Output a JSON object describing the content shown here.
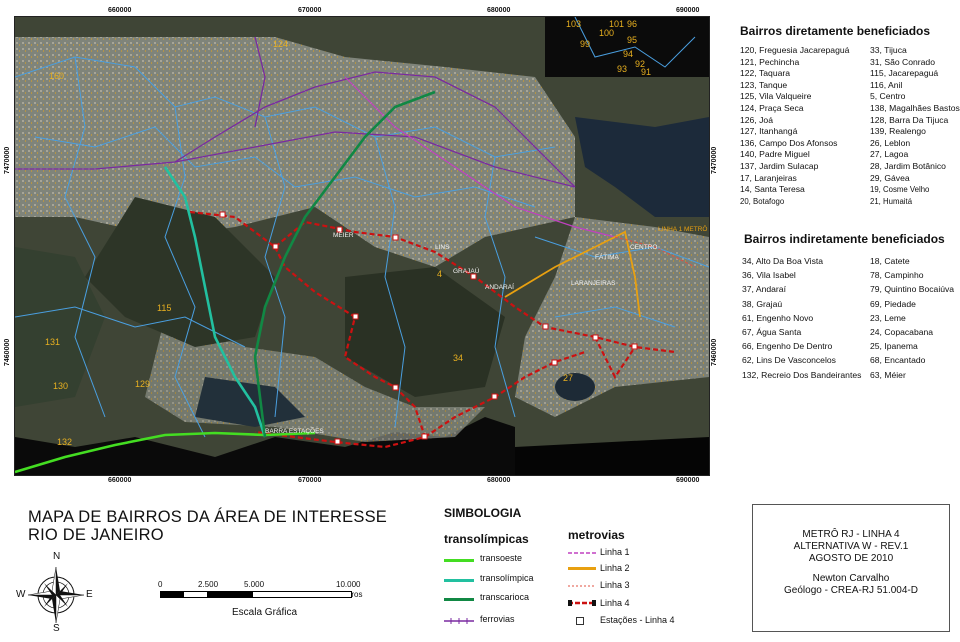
{
  "map": {
    "coords_top": [
      "660000",
      "670000",
      "680000",
      "690000"
    ],
    "coords_bottom": [
      "660000",
      "670000",
      "680000",
      "690000"
    ],
    "coords_left": [
      "7470000",
      "7460000"
    ],
    "coords_right": [
      "7470000",
      "7460000"
    ],
    "neighborhood_labels": [
      "103",
      "99",
      "100",
      "101",
      "96",
      "95",
      "94",
      "92",
      "93",
      "91",
      "124",
      "160",
      "115",
      "131",
      "130",
      "129",
      "132",
      "34",
      "27",
      "4"
    ],
    "station_labels": [
      "BARRA ESTAÇÕES",
      "GRAJAÚ",
      "ANDARAÍ",
      "LINS",
      "MÉIER",
      "CENTRO",
      "FÁTIMA",
      "LARANJEIRAS",
      "LINHA 1 METRÔ"
    ],
    "colors": {
      "linha1": "#c040c0",
      "linha2": "#e8a010",
      "linha3": "#e05040",
      "linha4": "#cc1111",
      "transoeste": "#44dd22",
      "transolimpica": "#22c0a0",
      "transcarioca": "#118844",
      "ferrovias": "#7a2aa0",
      "boundaries": "#4a9fe0"
    }
  },
  "direct": {
    "title": "Bairros diretamente beneficiados",
    "col1": [
      "120, Freguesia Jacarepaguá",
      "121, Pechincha",
      "122, Taquara",
      "123, Tanque",
      "125, Vila Valqueire",
      "124, Praça Seca",
      "126, Joá",
      "127, Itanhangá",
      "136, Campo Dos Afonsos",
      "140, Padre Miguel",
      "137, Jardim Sulacap",
      "17, Laranjeiras",
      "14, Santa Teresa",
      "20, Botafogo"
    ],
    "col2": [
      "33, Tijuca",
      "31, São Conrado",
      "115, Jacarepaguá",
      "116, Anil",
      "5, Centro",
      "138, Magalhães Bastos",
      "128, Barra Da Tijuca",
      "139, Realengo",
      "26, Leblon",
      "27, Lagoa",
      "28, Jardim Botânico",
      "29, Gávea",
      "19, Cosme Velho",
      "21, Humaitá"
    ]
  },
  "indirect": {
    "title": "Bairros indiretamente beneficiados",
    "col1": [
      "34, Alto Da Boa Vista",
      "36, Vila Isabel",
      "37, Andaraí",
      "38, Grajaú",
      "61, Engenho Novo",
      "67, Água Santa",
      "66, Engenho De Dentro",
      "62, Lins De Vasconcelos",
      "132, Recreio Dos Bandeirantes"
    ],
    "col2": [
      "18, Catete",
      "78, Campinho",
      "79, Quintino Bocaiúva",
      "69, Piedade",
      "23, Leme",
      "24, Copacabana",
      "25, Ipanema",
      "68, Encantado",
      "63, Méier"
    ]
  },
  "title": {
    "line1": "MAPA DE BAIRROS DA ÁREA DE INTERESSE",
    "line2": "RIO DE JANEIRO"
  },
  "compass": {
    "n": "N",
    "s": "S",
    "e": "E",
    "w": "W"
  },
  "scale": {
    "ticks": [
      "0",
      "2.500",
      "5.000",
      "10.000"
    ],
    "unit": "Metros",
    "caption": "Escala Gráfica"
  },
  "legend": {
    "heading": "SIMBOLOGIA",
    "transolimpicas_heading": "transolímpicas",
    "transolimpicas": [
      {
        "label": "transoeste",
        "color": "#44dd22"
      },
      {
        "label": "transolímpica",
        "color": "#22c0a0"
      },
      {
        "label": "transcarioca",
        "color": "#118844"
      }
    ],
    "ferrovias": "ferrovias",
    "metrovias_heading": "metrovias",
    "metrovias": [
      {
        "label": "Linha 1",
        "color": "#c040c0"
      },
      {
        "label": "Linha 2",
        "color": "#e8a010"
      },
      {
        "label": "Linha 3",
        "color": "#e05040"
      },
      {
        "label": "Linha 4",
        "color": "#cc1111"
      }
    ],
    "estacoes": "Estações - Linha 4"
  },
  "info": {
    "line1": "METRÔ RJ - LINHA 4",
    "line2": "ALTERNATIVA W - REV.1",
    "line3": "AGOSTO DE 2010",
    "author": "Newton Carvalho",
    "role": "Geólogo - CREA-RJ 51.004-D"
  }
}
